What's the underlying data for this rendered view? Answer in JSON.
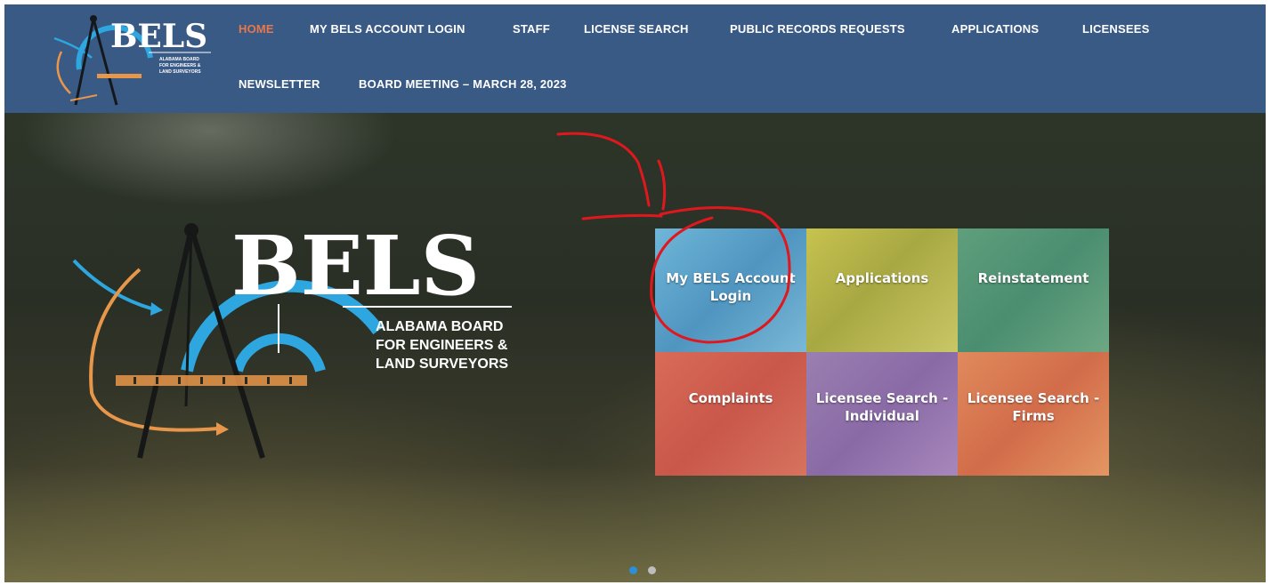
{
  "colors": {
    "header_bg": "#3a5a86",
    "nav_active": "#e8774a",
    "nav_text": "#ffffff",
    "annotation_red": "#e0181e",
    "dot_active": "#2b8fd6",
    "dot_inactive": "#bdbdbd"
  },
  "logo": {
    "wordmark": "BELS",
    "small_tagline_lines": [
      "ALABAMA BOARD",
      "FOR ENGINEERS &",
      "LAND SURVEYORS"
    ],
    "big_tagline_lines": [
      "ALABAMA BOARD",
      "FOR ENGINEERS &",
      "LAND SURVEYORS"
    ]
  },
  "nav": {
    "items": [
      {
        "label": "HOME",
        "active": true
      },
      {
        "label": "MY BELS ACCOUNT LOGIN"
      },
      {
        "label": "STAFF"
      },
      {
        "label": "LICENSE SEARCH"
      },
      {
        "label": "PUBLIC RECORDS REQUESTS"
      },
      {
        "label": "APPLICATIONS"
      },
      {
        "label": "LICENSEES"
      },
      {
        "label": "NEWSLETTER"
      },
      {
        "label": "BOARD MEETING – MARCH 28, 2023"
      }
    ]
  },
  "tiles": [
    {
      "label": "My BELS Account Login",
      "icon": "tile-photo"
    },
    {
      "label": "Applications",
      "icon": "tile-photo"
    },
    {
      "label": "Reinstatement",
      "icon": "tile-photo"
    },
    {
      "label": "Complaints",
      "icon": "tile-photo"
    },
    {
      "label": "Licensee Search - Individual",
      "icon": "tile-photo"
    },
    {
      "label": "Licensee Search - Firms",
      "icon": "tile-photo"
    }
  ],
  "slider": {
    "count": 2,
    "active_index": 0
  }
}
